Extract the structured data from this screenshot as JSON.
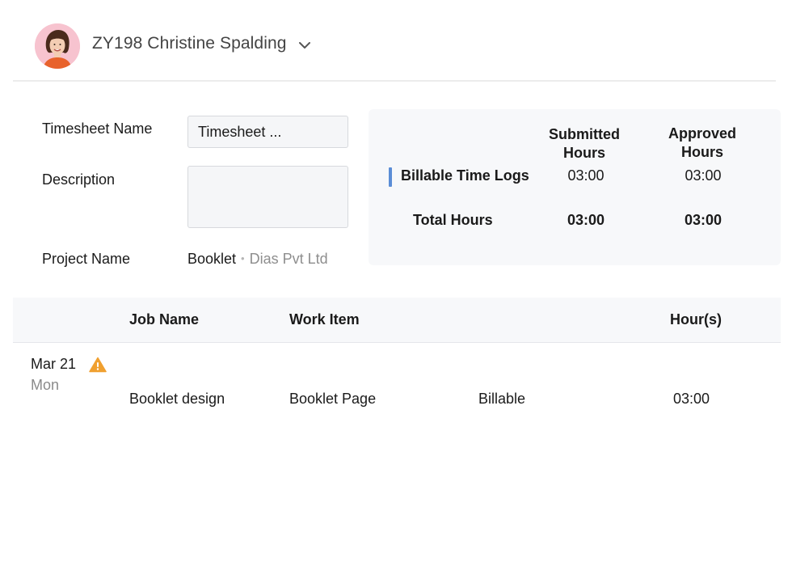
{
  "header": {
    "user_name": "ZY198 Christine Spalding",
    "avatar_icon": "user-avatar",
    "dropdown_icon": "chevron-down-icon"
  },
  "form": {
    "timesheet_name_label": "Timesheet Name",
    "timesheet_name_value": "Timesheet ...",
    "description_label": "Description",
    "description_value": "",
    "project_name_label": "Project Name",
    "project_name": "Booklet",
    "project_separator": "•",
    "project_client": "Dias Pvt Ltd"
  },
  "summary": {
    "submitted_header": "Submitted Hours",
    "approved_header": "Approved Hours",
    "rows": [
      {
        "label": "Billable Time Logs",
        "submitted": "03:00",
        "approved": "03:00"
      },
      {
        "label": "Total Hours",
        "submitted": "03:00",
        "approved": "03:00"
      }
    ],
    "accent_color": "#5b8dd6"
  },
  "table": {
    "headers": {
      "job_name": "Job Name",
      "work_item": "Work Item",
      "hours": "Hour(s)"
    },
    "rows": [
      {
        "date": "Mar 21",
        "day": "Mon",
        "warning_icon": "warning-icon",
        "job_name": "Booklet design",
        "work_item": "Booklet Page",
        "billing": "Billable",
        "hours": "03:00"
      }
    ]
  },
  "colors": {
    "warning": "#f0a030",
    "panel_bg": "#f7f8fa"
  }
}
